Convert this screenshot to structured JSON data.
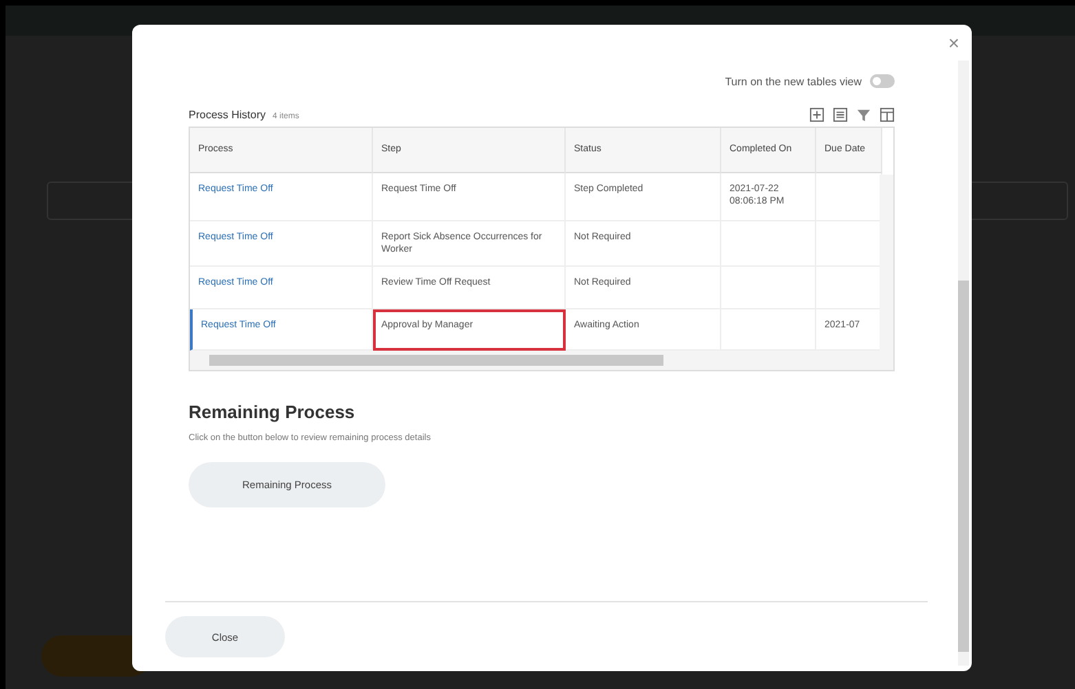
{
  "dialog": {
    "close_symbol": "×"
  },
  "toggle": {
    "label": "Turn on the new tables view",
    "on": false
  },
  "process_history": {
    "title": "Process History",
    "count": "4 items",
    "columns": [
      "Process",
      "Step",
      "Status",
      "Completed On",
      "Due Date"
    ],
    "rows": [
      {
        "process": "Request Time Off",
        "step": "Request Time Off",
        "status": "Step Completed",
        "completed_on": "2021-07-22 08:06:18 PM",
        "selected": false,
        "highlighted": false
      },
      {
        "process": "Request Time Off",
        "step": "Report Sick Absence Occurrences for Worker",
        "status": "Not Required",
        "selected": false,
        "highlighted": false
      },
      {
        "process": "Request Time Off",
        "step": "Review Time Off Request",
        "status": "Not Required",
        "selected": false,
        "highlighted": false
      },
      {
        "process": "Request Time Off",
        "step": "Approval by Manager",
        "status": "Awaiting Action",
        "due_date": "2021-07",
        "selected": true,
        "highlighted": true
      }
    ]
  },
  "remaining": {
    "title": "Remaining Process",
    "description": "Click on the button below to review remaining process details",
    "button": "Remaining Process"
  },
  "footer": {
    "button": "Close"
  }
}
